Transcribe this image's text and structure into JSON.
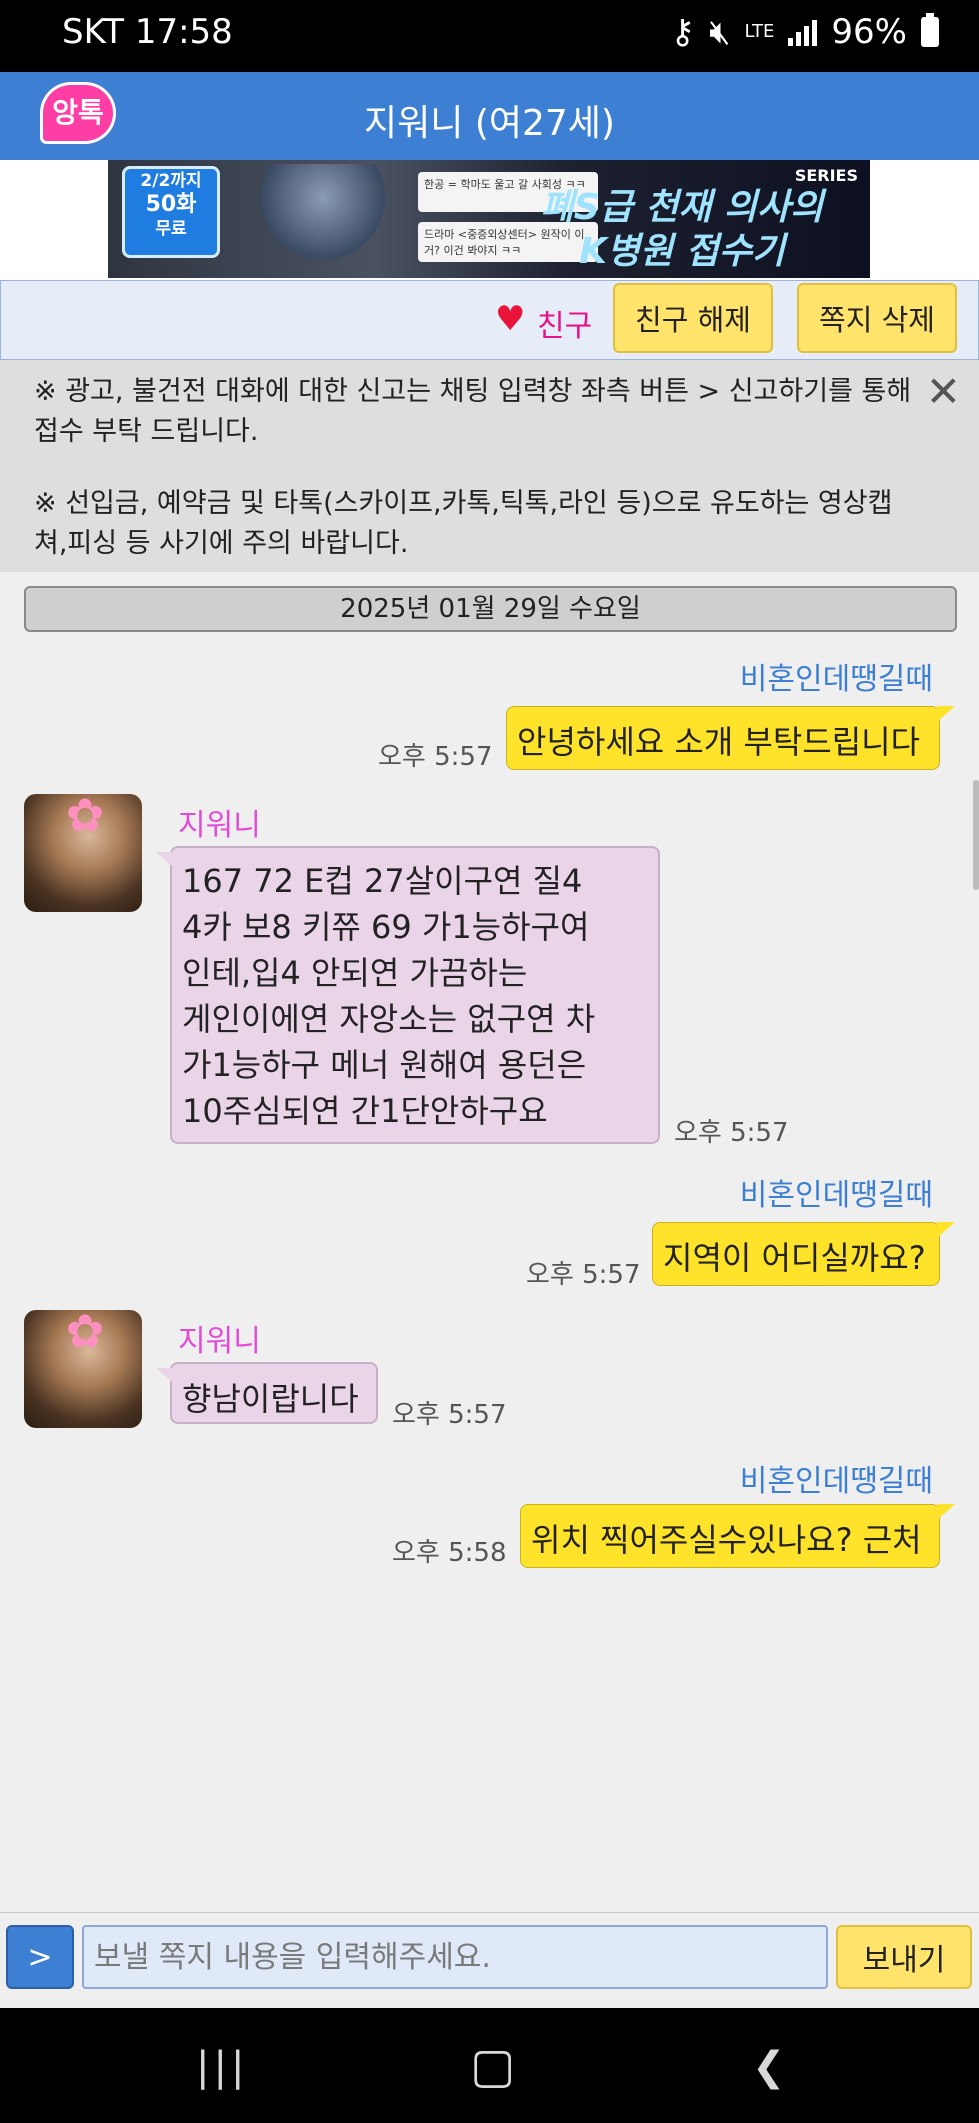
{
  "status": {
    "carrier_time": "SKT 17:58",
    "net": "LTE",
    "battery": "96%"
  },
  "app": {
    "logo_text": "앙톡",
    "title": "지워니 (여27세)"
  },
  "banner": {
    "badge_line1": "2/2까지",
    "badge_line2": "50화",
    "badge_line3": "무료",
    "series": "SERIES",
    "title_line1": "폐S급 천재 의사의",
    "title_line2": "K병원 접수기",
    "card1": "한공 = 학마도 울고 갈 사회성 ㅋㅋ",
    "card2": "드라마 <중증외상센터> 원작이 이거? 이건 봐야지 ㅋㅋ"
  },
  "friendbar": {
    "friend_label": "친구",
    "unfriend": "친구 해제",
    "delete": "쪽지 삭제"
  },
  "notice": {
    "line1": "※ 광고, 불건전 대화에 대한 신고는 채팅 입력창 좌측 버튼 > 신고하기를 통해 접수 부탁 드립니다.",
    "line2": "※ 선입금, 예약금 및 타톡(스카이프,카톡,틱톡,라인 등)으로 유도하는 영상캡쳐,피싱 등 사기에 주의 바랍니다."
  },
  "date": "2025년 01월 29일 수요일",
  "messages": [
    {
      "sender": "비혼인데땡길때",
      "text": "안녕하세요 소개 부탁드립니다",
      "time": "오후 5:57"
    },
    {
      "sender": "지워니",
      "lines": [
        "167 72 E컵 27살이구연 질4",
        "4카 보8 키쮸 69 가1능하구여",
        "인테,입4 안되연 가끔하는",
        "게인이에연 자앙소는 없구연 차",
        "가1능하구 메너 원해여 용던은",
        "10주심되연 간1단안하구요"
      ],
      "time": "오후 5:57"
    },
    {
      "sender": "비혼인데땡길때",
      "text": "지역이 어디실까요?",
      "time": "오후 5:57"
    },
    {
      "sender": "지워니",
      "text": "향남이랍니다",
      "time": "오후 5:57"
    },
    {
      "sender": "비혼인데땡길때",
      "text": "위치 찍어주실수있나요? 근처",
      "time": "오후 5:58"
    }
  ],
  "composer": {
    "toggle": ">",
    "placeholder": "보낼 쪽지 내용을 입력해주세요.",
    "send": "보내기"
  },
  "colors": {
    "header": "#3d7fd3",
    "out_bubble": "#ffe22a",
    "in_bubble": "#ead5e8",
    "sender_name": "#3d7fd3",
    "recv_name": "#e24bd8"
  }
}
